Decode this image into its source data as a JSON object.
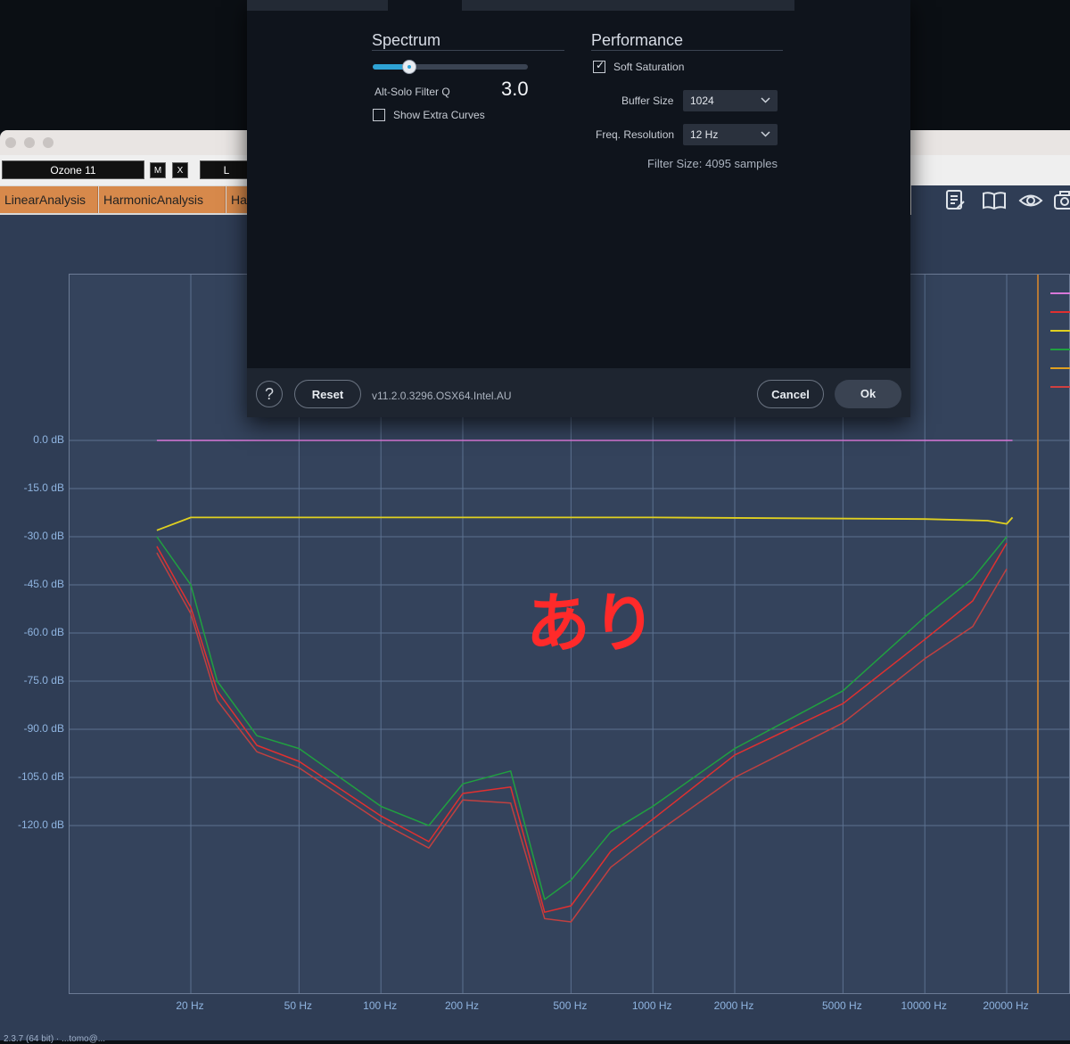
{
  "host": {
    "preset_name": "Ozone 11",
    "mini_buttons": [
      "M",
      "X"
    ],
    "preset_b_partial": "L",
    "tabs": [
      "LinearAnalysis",
      "HarmonicAnalysis",
      "Ha"
    ]
  },
  "toolbar_icons": [
    "notes-icon",
    "book-icon",
    "eye-icon",
    "camera-icon"
  ],
  "analyzer": {
    "overlay_text": "あり",
    "status_text": "2.3.7 (64 bit) · ...tomo@...",
    "db_labels": [
      "0.0 dB",
      "-15.0 dB",
      "-30.0 dB",
      "-45.0 dB",
      "-60.0 dB",
      "-75.0 dB",
      "-90.0 dB",
      "-105.0 dB",
      "-120.0 dB"
    ],
    "hz_labels": [
      "20 Hz",
      "50 Hz",
      "100 Hz",
      "200 Hz",
      "500 Hz",
      "1000 Hz",
      "2000 Hz",
      "5000 Hz",
      "10000 Hz",
      "20000 Hz"
    ],
    "legend_colors": [
      "#d878d8",
      "#e03030",
      "#e0d020",
      "#20a040",
      "#e0a020",
      "#d04040"
    ]
  },
  "chart_data": {
    "type": "line",
    "xlabel": "",
    "ylabel": "",
    "x_scale": "log",
    "xlim": [
      12,
      22000
    ],
    "ylim": [
      -155,
      0
    ],
    "grid": true,
    "series": [
      {
        "color": "#d878d8",
        "x": [
          15,
          100,
          1000,
          10000,
          21000
        ],
        "y": [
          0,
          0,
          0,
          0,
          0
        ]
      },
      {
        "color": "#e0d020",
        "x": [
          15,
          20,
          50,
          100,
          1000,
          10000,
          17000,
          20000,
          21000
        ],
        "y": [
          -28,
          -24,
          -24,
          -24,
          -24,
          -24.5,
          -25,
          -26,
          -24
        ]
      },
      {
        "color": "#20a040",
        "x": [
          15,
          20,
          25,
          35,
          50,
          100,
          150,
          200,
          300,
          400,
          500,
          700,
          1000,
          2000,
          5000,
          10000,
          15000,
          20000
        ],
        "y": [
          -30,
          -45,
          -75,
          -92,
          -96,
          -114,
          -120,
          -107,
          -103,
          -143,
          -137,
          -122,
          -114,
          -96,
          -78,
          -55,
          -43,
          -30
        ]
      },
      {
        "color": "#e03030",
        "x": [
          15,
          20,
          25,
          35,
          50,
          100,
          150,
          200,
          300,
          400,
          500,
          700,
          1000,
          2000,
          5000,
          10000,
          15000,
          20000
        ],
        "y": [
          -33,
          -52,
          -78,
          -95,
          -100,
          -117,
          -125,
          -110,
          -108,
          -147,
          -145,
          -128,
          -118,
          -98,
          -82,
          -62,
          -50,
          -32
        ]
      },
      {
        "color": "#c04040",
        "x": [
          15,
          20,
          25,
          35,
          50,
          100,
          150,
          200,
          300,
          400,
          500,
          700,
          1000,
          2000,
          5000,
          10000,
          15000,
          20000
        ],
        "y": [
          -35,
          -54,
          -81,
          -97,
          -102,
          -119,
          -127,
          -112,
          -113,
          -149,
          -150,
          -133,
          -123,
          -105,
          -88,
          -68,
          -58,
          -40
        ]
      }
    ]
  },
  "dialog": {
    "spectrum": {
      "title": "Spectrum",
      "filter_q_label": "Alt-Solo Filter Q",
      "filter_q_value": "3.0",
      "slider_position": 0.24,
      "show_extra_curves_label": "Show Extra Curves",
      "show_extra_curves_checked": false
    },
    "performance": {
      "title": "Performance",
      "soft_saturation_label": "Soft Saturation",
      "soft_saturation_checked": true,
      "buffer_size_label": "Buffer Size",
      "buffer_size_value": "1024",
      "freq_resolution_label": "Freq. Resolution",
      "freq_resolution_value": "12 Hz",
      "filter_size_text": "Filter Size: 4095 samples"
    },
    "footer": {
      "help_label": "?",
      "reset_label": "Reset",
      "version": "v11.2.0.3296.OSX64.Intel.AU",
      "cancel_label": "Cancel",
      "ok_label": "Ok"
    }
  }
}
